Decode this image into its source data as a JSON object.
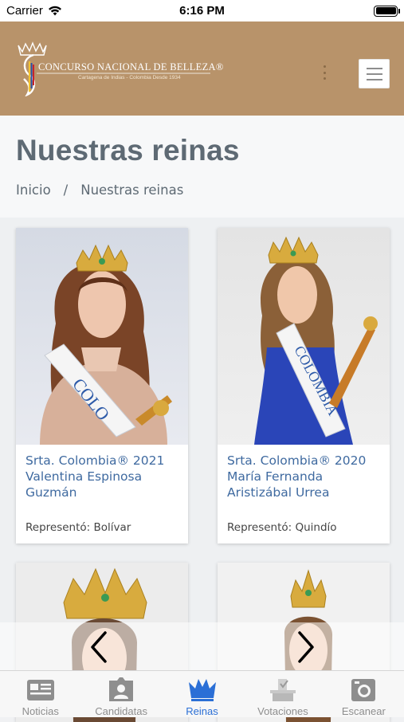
{
  "status_bar": {
    "carrier": "Carrier",
    "time": "6:16 PM"
  },
  "header": {
    "brand_title": "CONCURSO NACIONAL DE BELLEZA®",
    "brand_subtitle": "Cartagena de Indias - Colombia  Desde 1934",
    "brand_color": "#b8936a"
  },
  "page": {
    "title": "Nuestras reinas",
    "breadcrumb": [
      "Inicio",
      "/",
      "Nuestras reinas"
    ]
  },
  "cards": [
    {
      "name": "Srta. Colombia® 2021 Valentina Espinosa Guzmán",
      "represented": "Representó: Bolívar",
      "dress_color": "#d7b09a",
      "bg": "#d8dde6"
    },
    {
      "name": "Srta. Colombia® 2020 María Fernanda Aristizábal Urrea",
      "represented": "Representó: Quindío",
      "dress_color": "#2a45b8",
      "bg": "#e6e6e6"
    },
    {
      "name": "",
      "represented": "",
      "dress_color": "",
      "bg": "#ececec"
    },
    {
      "name": "",
      "represented": "",
      "dress_color": "",
      "bg": "#f1f1f1"
    }
  ],
  "tabs": [
    {
      "label": "Noticias",
      "icon": "newspaper-icon",
      "active": false
    },
    {
      "label": "Candidatas",
      "icon": "id-card-icon",
      "active": false
    },
    {
      "label": "Reinas",
      "icon": "crown-icon",
      "active": true
    },
    {
      "label": "Votaciones",
      "icon": "ballot-icon",
      "active": false
    },
    {
      "label": "Escanear",
      "icon": "scanner-icon",
      "active": false
    }
  ],
  "accent_color": "#2b6fd6"
}
